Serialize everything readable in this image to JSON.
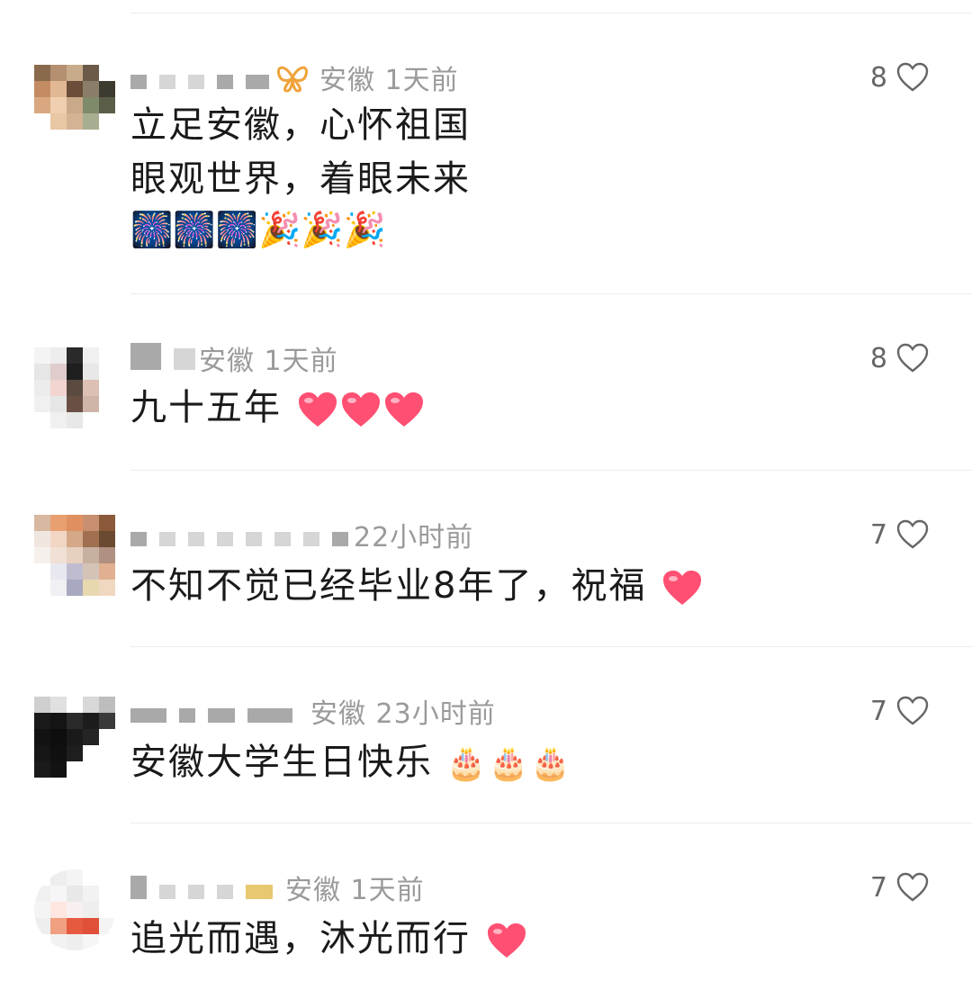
{
  "comments": [
    {
      "location_time": "安徽 1天前",
      "likes": "8",
      "lines": [
        "立足安徽，心怀祖国",
        "眼观世界，着眼未来"
      ],
      "emoji_line": "🎆🎆🎆🎉🎉🎉",
      "badge": "butterfly-badge-icon"
    },
    {
      "location_time": "安徽 1天前",
      "likes": "8",
      "text": "九十五年",
      "trailing_emoji": "heart-icon x3"
    },
    {
      "location_time": "22小时前",
      "likes": "7",
      "text": "不知不觉已经毕业8年了，祝福",
      "trailing_emoji": "heart-icon x1"
    },
    {
      "location_time": "安徽 23小时前",
      "likes": "7",
      "text": "安徽大学生日快乐",
      "trailing_emoji": "🎂🎂🎂"
    },
    {
      "location_time": "安徽 1天前",
      "likes": "7",
      "text": "追光而遇，沐光而行",
      "trailing_emoji": "heart-icon x1"
    }
  ],
  "colors": {
    "text": "#1a1a1a",
    "meta": "#9a9a9a",
    "badge": "#f0a33a",
    "heart": "#ff4f72"
  }
}
